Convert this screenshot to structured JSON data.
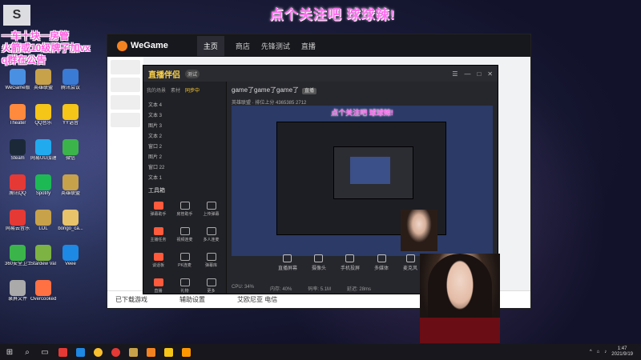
{
  "banner": "点个关注吧 球球辣!",
  "overlay": {
    "line1": "一车十块一房管",
    "line2": "火箭或10级牌子加vx",
    "line3": "q群在公告"
  },
  "desktop_icons": [
    {
      "label": "WeGame版",
      "color": "#4a90e2"
    },
    {
      "label": "英雄联盟",
      "color": "#c8a24a"
    },
    {
      "label": "腾讯会议",
      "color": "#3a7bd5"
    },
    {
      "label": "Theater",
      "color": "#ff8a3d"
    },
    {
      "label": "QQ音乐",
      "color": "#f5c518"
    },
    {
      "label": "YY语音",
      "color": "#f5c518"
    },
    {
      "label": "Steam",
      "color": "#1b2838"
    },
    {
      "label": "网易UU加速",
      "color": "#22aaee"
    },
    {
      "label": "微信",
      "color": "#3bb54a"
    },
    {
      "label": "腾讯QQ",
      "color": "#e53935"
    },
    {
      "label": "Spotify",
      "color": "#1db954"
    },
    {
      "label": "英雄联盟",
      "color": "#c8a24a"
    },
    {
      "label": "网易云音乐",
      "color": "#e53935"
    },
    {
      "label": "LOL",
      "color": "#c8a24a"
    },
    {
      "label": "bongo_ca...",
      "color": "#e8c36a"
    },
    {
      "label": "360安全卫士",
      "color": "#3bb54a"
    },
    {
      "label": "Stardew Valley",
      "color": "#7cb342"
    },
    {
      "label": "Veee",
      "color": "#1e88e5"
    },
    {
      "label": "录屏文件",
      "color": "#aaaaaa"
    },
    {
      "label": "Overcooked 2",
      "color": "#ff7043"
    }
  ],
  "wegame": {
    "logo": "WeGame",
    "tabs": [
      "主页",
      "商店",
      "先锋测试",
      "直播"
    ],
    "bottom_left": "已下载游戏",
    "bottom_mid": "辅助设置",
    "bottom_right": "艾欧尼亚 电信"
  },
  "live": {
    "logo": "直播伴侣",
    "version": "测试",
    "left_tabs": [
      "我的场景",
      "素材",
      "同步中"
    ],
    "scenes": [
      "文本 4",
      "文本 3",
      "图片 3",
      "文本 2",
      "窗口 2",
      "图片 2",
      "窗口 22",
      "文本 1"
    ],
    "tools_title": "工具箱",
    "tools": [
      "弹幕助手",
      "房管助手",
      "上传弹幕",
      "主播任务",
      "视频连麦",
      "多人连麦",
      "谈话板",
      "PK连麦",
      "弹幕库",
      "直播",
      "礼物",
      "更多"
    ],
    "title": "game了game了game了",
    "live_tag": "直播",
    "stats": "英雄联盟 · 排位上分  4365385  2712",
    "preview_banner": "点个关注吧 球球辣!",
    "toolbar": [
      "直播屏幕",
      "摄像头",
      "手机投屏",
      "多媒体",
      "麦克风",
      "扬声器"
    ],
    "status": [
      "CPU: 34%",
      "内存: 40%",
      "码率: 5.1M",
      "延迟: 28ms"
    ]
  },
  "taskbar": {
    "time": "1:47",
    "date": "2021/9/19"
  }
}
